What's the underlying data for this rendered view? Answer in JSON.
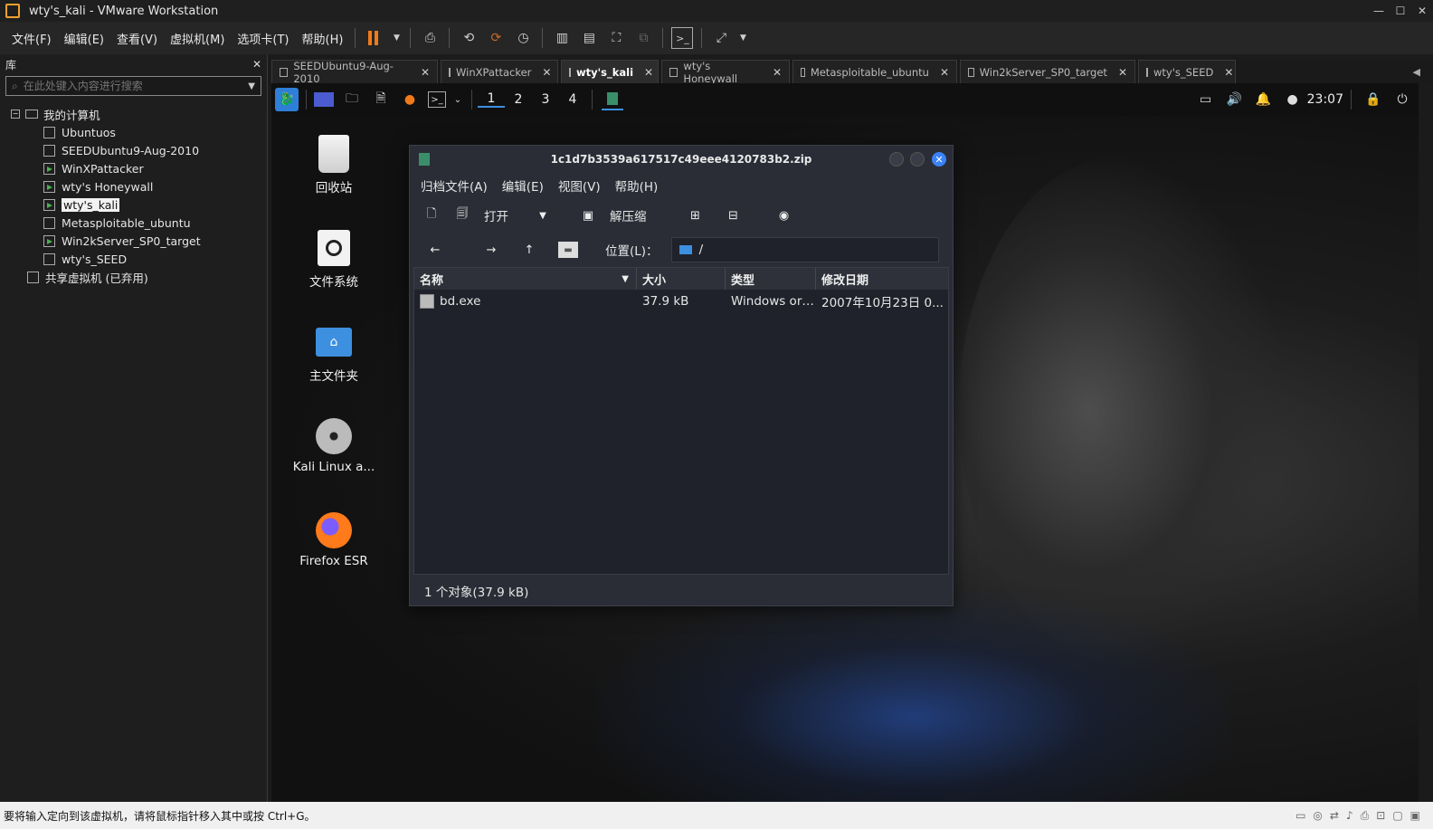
{
  "window": {
    "title": "wty's_kali - VMware Workstation"
  },
  "menubar": {
    "items": [
      "文件(F)",
      "编辑(E)",
      "查看(V)",
      "虚拟机(M)",
      "选项卡(T)",
      "帮助(H)"
    ]
  },
  "library": {
    "header": "库",
    "close": "✕",
    "search_placeholder": "在此处键入内容进行搜索",
    "root": "我的计算机",
    "vms": [
      {
        "label": "Ubuntuos",
        "running": false
      },
      {
        "label": "SEEDUbuntu9-Aug-2010",
        "running": false
      },
      {
        "label": "WinXPattacker",
        "running": true
      },
      {
        "label": "wty's Honeywall",
        "running": true
      },
      {
        "label": "wty's_kali",
        "running": true,
        "selected": true
      },
      {
        "label": "Metasploitable_ubuntu",
        "running": false
      },
      {
        "label": "Win2kServer_SP0_target",
        "running": true
      },
      {
        "label": "wty's_SEED",
        "running": false
      }
    ],
    "shared": "共享虚拟机 (已弃用)"
  },
  "tabs": [
    {
      "label": "SEEDUbuntu9-Aug-2010",
      "active": false
    },
    {
      "label": "WinXPattacker",
      "active": false
    },
    {
      "label": "wty's_kali",
      "active": true
    },
    {
      "label": "wty's Honeywall",
      "active": false
    },
    {
      "label": "Metasploitable_ubuntu",
      "active": false
    },
    {
      "label": "Win2kServer_SP0_target",
      "active": false
    },
    {
      "label": "wty's_SEED",
      "active": false
    }
  ],
  "kali_panel": {
    "workspaces": [
      "1",
      "2",
      "3",
      "4"
    ],
    "active_workspace": "1",
    "clock": "23:07"
  },
  "desktop_icons": [
    {
      "label": "回收站",
      "icon": "trash-icon"
    },
    {
      "label": "文件系统",
      "icon": "filesystem-icon"
    },
    {
      "label": "主文件夹",
      "icon": "home-folder-icon"
    },
    {
      "label": "Kali Linux a...",
      "icon": "disc-icon"
    },
    {
      "label": "Firefox ESR",
      "icon": "firefox-icon"
    }
  ],
  "archive": {
    "title": "1c1d7b3539a617517c49eee4120783b2.zip",
    "menu": [
      "归档文件(A)",
      "编辑(E)",
      "视图(V)",
      "帮助(H)"
    ],
    "toolbar": {
      "open": "打开",
      "extract": "解压缩"
    },
    "location_label": "位置(L)：",
    "location_value": "/",
    "columns": [
      "名称",
      "大小",
      "类型",
      "修改日期"
    ],
    "files": [
      {
        "name": "bd.exe",
        "size": "37.9 kB",
        "type": "Windows or…",
        "modified": "2007年10月23日 0..."
      }
    ],
    "status": "1 个对象(37.9 kB)"
  },
  "statusbar": {
    "text": "要将输入定向到该虚拟机，请将鼠标指针移入其中或按 Ctrl+G。"
  },
  "colors": {
    "accent": "#3b82f6",
    "pause": "#f07a1a",
    "running": "#4caf50"
  }
}
